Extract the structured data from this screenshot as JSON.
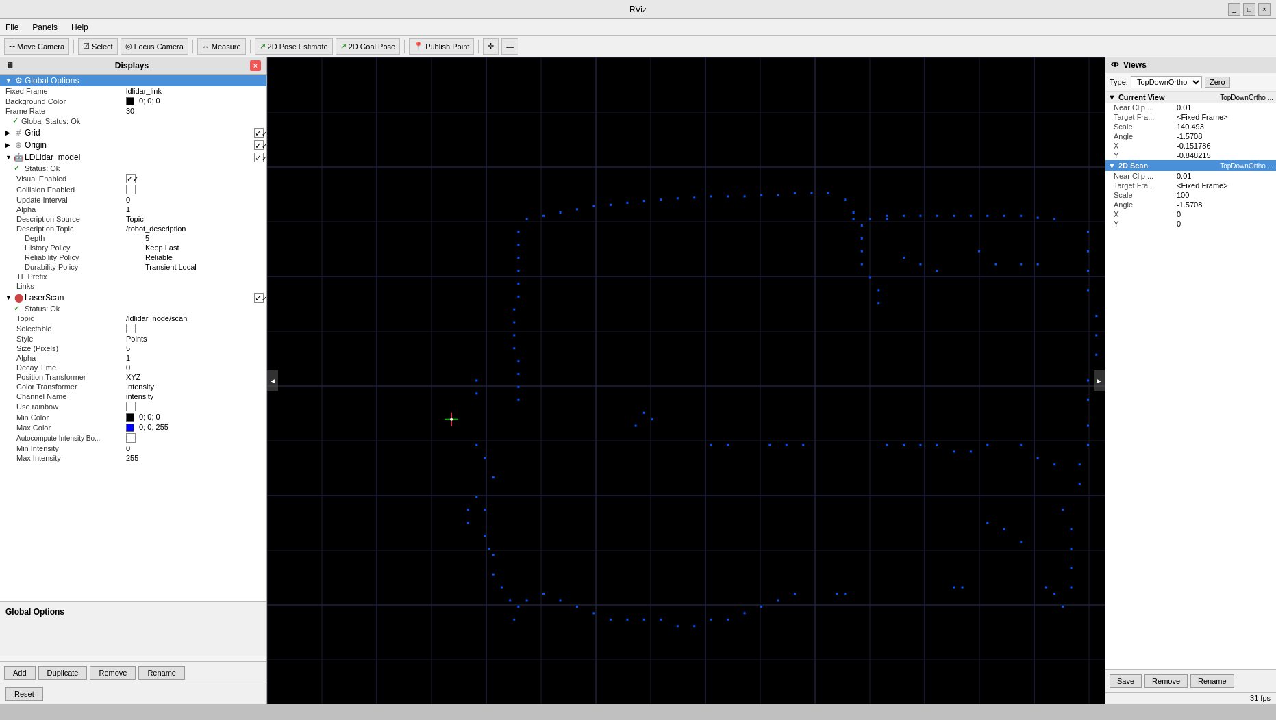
{
  "titlebar": {
    "title": "RViz",
    "controls": [
      "_",
      "□",
      "×"
    ]
  },
  "menubar": {
    "items": [
      "File",
      "Panels",
      "Help"
    ]
  },
  "toolbar": {
    "buttons": [
      {
        "label": "Move Camera",
        "icon": "move-icon"
      },
      {
        "label": "Select",
        "icon": "select-icon"
      },
      {
        "label": "Focus Camera",
        "icon": "focus-icon"
      },
      {
        "label": "Measure",
        "icon": "measure-icon"
      },
      {
        "label": "2D Pose Estimate",
        "icon": "pose-icon"
      },
      {
        "label": "2D Goal Pose",
        "icon": "goal-icon"
      },
      {
        "label": "Publish Point",
        "icon": "publish-icon"
      }
    ]
  },
  "displays": {
    "header": "Displays",
    "tree": {
      "global_options": {
        "label": "Global Options",
        "selected": true,
        "properties": [
          {
            "name": "Fixed Frame",
            "value": "ldlidar_link"
          },
          {
            "name": "Background Color",
            "value": "0; 0; 0",
            "color": "#000000"
          },
          {
            "name": "Frame Rate",
            "value": "30"
          },
          {
            "name": "Global Status: Ok",
            "value": ""
          }
        ]
      },
      "grid": {
        "label": "Grid",
        "checked": true,
        "icon": "grid-icon"
      },
      "origin": {
        "label": "Origin",
        "checked": true,
        "icon": "origin-icon"
      },
      "ldlidar_model": {
        "label": "LDLidar_model",
        "checked": true,
        "icon": "model-icon",
        "properties": [
          {
            "name": "Status: Ok",
            "value": ""
          },
          {
            "name": "Visual Enabled",
            "value": "checked"
          },
          {
            "name": "Collision Enabled",
            "value": "unchecked"
          },
          {
            "name": "Update Interval",
            "value": "0"
          },
          {
            "name": "Alpha",
            "value": "1"
          },
          {
            "name": "Description Source",
            "value": "Topic"
          },
          {
            "name": "Description Topic",
            "value": "/robot_description"
          },
          {
            "name": "Depth",
            "value": "5"
          },
          {
            "name": "History Policy",
            "value": "Keep Last"
          },
          {
            "name": "Reliability Policy",
            "value": "Reliable"
          },
          {
            "name": "Durability Policy",
            "value": "Transient Local"
          },
          {
            "name": "TF Prefix",
            "value": ""
          },
          {
            "name": "Links",
            "value": ""
          }
        ]
      },
      "laser_scan": {
        "label": "LaserScan",
        "checked": true,
        "icon": "scan-icon",
        "properties": [
          {
            "name": "Status: Ok",
            "value": ""
          },
          {
            "name": "Topic",
            "value": "/ldlidar_node/scan"
          },
          {
            "name": "Selectable",
            "value": "unchecked"
          },
          {
            "name": "Style",
            "value": "Points"
          },
          {
            "name": "Size (Pixels)",
            "value": "5"
          },
          {
            "name": "Alpha",
            "value": "1"
          },
          {
            "name": "Decay Time",
            "value": "0"
          },
          {
            "name": "Position Transformer",
            "value": "XYZ"
          },
          {
            "name": "Color Transformer",
            "value": "Intensity"
          },
          {
            "name": "Channel Name",
            "value": "intensity"
          },
          {
            "name": "Use rainbow",
            "value": "unchecked"
          },
          {
            "name": "Min Color",
            "value": "0; 0; 0",
            "color": "#000000"
          },
          {
            "name": "Max Color",
            "value": "0; 0; 255",
            "color": "#0000ff"
          },
          {
            "name": "Autocompute Intensity Bo...",
            "value": "unchecked"
          },
          {
            "name": "Min Intensity",
            "value": "0"
          },
          {
            "name": "Max Intensity",
            "value": "255"
          }
        ]
      }
    },
    "bottom_section": "Global Options",
    "buttons": [
      "Add",
      "Duplicate",
      "Remove",
      "Rename"
    ]
  },
  "views": {
    "header": "Views",
    "type_label": "Type:",
    "type_value": "TopDownOrtho",
    "zero_button": "Zero",
    "sections": [
      {
        "label": "Current View",
        "type": "TopDownOrtho ...",
        "properties": [
          {
            "name": "Near Clip ...",
            "value": "0.01"
          },
          {
            "name": "Target Fra...",
            "value": "<Fixed Frame>"
          },
          {
            "name": "Scale",
            "value": "140.493"
          },
          {
            "name": "Angle",
            "value": "-1.5708"
          },
          {
            "name": "X",
            "value": "-0.151786"
          },
          {
            "name": "Y",
            "value": "-0.848215"
          }
        ]
      },
      {
        "label": "2D Scan",
        "type": "TopDownOrtho ...",
        "selected": true,
        "properties": [
          {
            "name": "Near Clip ...",
            "value": "0.01"
          },
          {
            "name": "Target Fra...",
            "value": "<Fixed Frame>"
          },
          {
            "name": "Scale",
            "value": "100"
          },
          {
            "name": "Angle",
            "value": "-1.5708"
          },
          {
            "name": "X",
            "value": "0"
          },
          {
            "name": "Y",
            "value": "0"
          }
        ]
      }
    ],
    "buttons": [
      "Save",
      "Remove",
      "Rename"
    ]
  },
  "statusbar": {
    "fps": "31 fps",
    "reset_button": "Reset"
  },
  "icons": {
    "move": "⊹",
    "select": "▣",
    "focus": "◎",
    "measure": "↔",
    "pose": "↗",
    "goal": "⚑",
    "publish": "📍",
    "arrow_left": "◄",
    "arrow_right": "►"
  }
}
